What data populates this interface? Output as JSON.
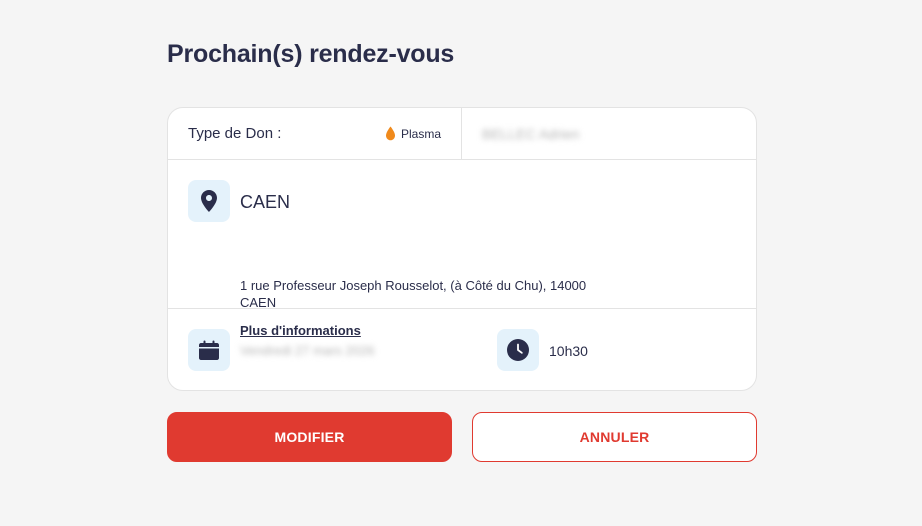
{
  "page": {
    "title": "Prochain(s) rendez-vous"
  },
  "appointment": {
    "don_label": "Type de Don :",
    "don_type": "Plasma",
    "donor_name": "BELLEC Adrien",
    "location": {
      "city": "CAEN",
      "address_line1": "1 rue Professeur Joseph Rousselot, (à Côté du Chu), 14000",
      "address_line2": "CAEN",
      "more_info_link": "Plus d'informations"
    },
    "date": "Vendredi 27 mars 2026",
    "time": "10h30"
  },
  "actions": {
    "modify_label": "MODIFIER",
    "cancel_label": "ANNULER"
  },
  "colors": {
    "primary_red": "#e03a30",
    "navy": "#2a2d4a",
    "icon_bg": "#e4f2fb",
    "plasma_orange": "#f08a1c"
  },
  "icons": {
    "don_type": "drop-icon",
    "location": "map-pin-icon",
    "date": "calendar-icon",
    "time": "clock-icon"
  }
}
